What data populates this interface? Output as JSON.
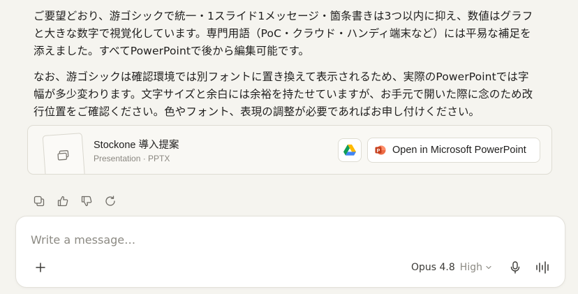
{
  "message": {
    "paragraphs": [
      "ご要望どおり、游ゴシックで統一・1スライド1メッセージ・箇条書きは3つ以内に抑え、数値はグラフと大きな数字で視覚化しています。専門用語（PoC・クラウド・ハンディ端末など）には平易な補足を添えました。すべてPowerPointで後から編集可能です。",
      "なお、游ゴシックは確認環境では別フォントに置き換えて表示されるため、実際のPowerPointでは字幅が多少変わります。文字サイズと余白には余裕を持たせていますが、お手元で開いた際に念のため改行位置をご確認ください。色やフォント、表現の調整が必要であればお申し付けください。"
    ]
  },
  "file_card": {
    "title": "Stockone 導入提案",
    "subtitle": "Presentation · PPTX",
    "open_label": "Open in Microsoft PowerPoint",
    "icons": {
      "thumbnail": "slides-icon",
      "drive": "google-drive-icon",
      "open": "powerpoint-icon"
    }
  },
  "message_actions": {
    "icons": [
      "copy-icon",
      "thumbs-up-icon",
      "thumbs-down-icon",
      "retry-icon"
    ]
  },
  "composer": {
    "placeholder": "Write a message…",
    "model": "Opus 4.8",
    "effort": "High",
    "icons": [
      "plus-icon",
      "chevron-down-icon",
      "microphone-icon",
      "voice-mode-icon"
    ]
  },
  "colors": {
    "page_background": "#f5f4ef",
    "text": "#1f1e1d",
    "muted_text": "#8c8a83",
    "border": "#dedcd3",
    "powerpoint_accent": "#d35230"
  }
}
